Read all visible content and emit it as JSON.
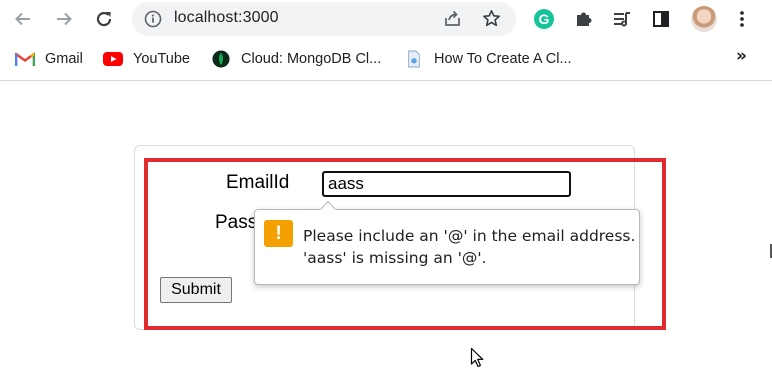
{
  "browser": {
    "url": "localhost:3000",
    "extensions": [
      "grammarly-icon",
      "puzzle-icon",
      "media-queue-icon",
      "side-panel-icon"
    ],
    "bookmarks": [
      {
        "label": "Gmail",
        "icon": "gmail-icon"
      },
      {
        "label": "YouTube",
        "icon": "youtube-icon"
      },
      {
        "label": "Cloud: MongoDB Cl...",
        "icon": "mongodb-icon"
      },
      {
        "label": "How To Create A Cl...",
        "icon": "page-icon"
      }
    ],
    "more_bookmarks": "»",
    "grammarly_letter": "G"
  },
  "form": {
    "email_label": "EmailId",
    "email_value": "aass",
    "password_label": "Pass",
    "submit_label": "Submit"
  },
  "validation": {
    "icon": "!",
    "line1": "Please include an '@' in the email address.",
    "line2": "'aass' is missing an '@'."
  },
  "colors": {
    "highlight": "#e02a2f",
    "warning": "#f4a000",
    "grammarly": "#15c39a"
  }
}
